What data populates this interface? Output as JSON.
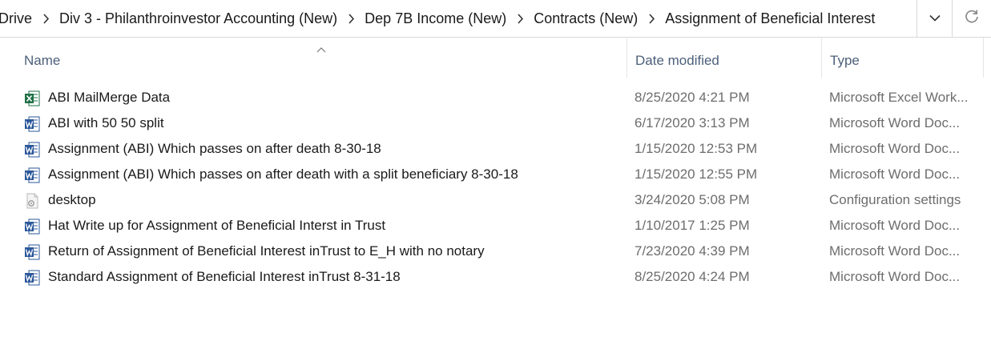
{
  "breadcrumb": [
    {
      "label": "Drive"
    },
    {
      "label": "Div 3 - Philanthroinvestor Accounting (New)"
    },
    {
      "label": "Dep 7B Income (New)"
    },
    {
      "label": "Contracts (New)"
    },
    {
      "label": "Assignment of Beneficial Interest"
    }
  ],
  "icons": {
    "breadcrumb_separator": "chevron-right-icon",
    "address_dropdown": "chevron-down-icon",
    "refresh": "refresh-icon",
    "sort": "sort-ascending-icon",
    "excel": "excel-file-icon",
    "word": "word-file-icon",
    "settings": "settings-file-icon"
  },
  "columns": {
    "name": "Name",
    "date_modified": "Date modified",
    "type": "Type"
  },
  "files": [
    {
      "name": "ABI MailMerge Data",
      "date": "8/25/2020 4:21 PM",
      "type": "Microsoft Excel Work...",
      "icon": "excel"
    },
    {
      "name": "ABI with 50 50 split",
      "date": "6/17/2020 3:13 PM",
      "type": "Microsoft Word Doc...",
      "icon": "word"
    },
    {
      "name": "Assignment (ABI) Which passes on after death 8-30-18",
      "date": "1/15/2020 12:53 PM",
      "type": "Microsoft Word Doc...",
      "icon": "word"
    },
    {
      "name": "Assignment (ABI) Which passes on after death with a split beneficiary 8-30-18",
      "date": "1/15/2020 12:55 PM",
      "type": "Microsoft Word Doc...",
      "icon": "word"
    },
    {
      "name": "desktop",
      "date": "3/24/2020 5:08 PM",
      "type": "Configuration settings",
      "icon": "settings"
    },
    {
      "name": "Hat Write up for Assignment of Beneficial Interst in Trust",
      "date": "1/10/2017 1:25 PM",
      "type": "Microsoft Word Doc...",
      "icon": "word"
    },
    {
      "name": "Return of Assignment of Beneficial Interest inTrust to E_H with no notary",
      "date": "7/23/2020 4:39 PM",
      "type": "Microsoft Word Doc...",
      "icon": "word"
    },
    {
      "name": "Standard Assignment of Beneficial Interest inTrust 8-31-18",
      "date": "8/25/2020 4:24 PM",
      "type": "Microsoft Word Doc...",
      "icon": "word"
    }
  ],
  "colors": {
    "header_text": "#4c607a",
    "secondary_text": "#6d6d6d",
    "excel_green": "#1e7145",
    "word_blue": "#2b579a"
  }
}
